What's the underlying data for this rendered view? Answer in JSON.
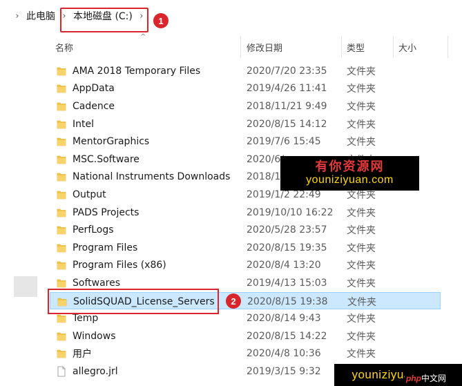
{
  "breadcrumb": {
    "items": [
      "此电脑",
      "本地磁盘 (C:)"
    ],
    "badge1": "1"
  },
  "columns": {
    "name": "名称",
    "modified": "修改日期",
    "type": "类型",
    "size": "大小"
  },
  "files": [
    {
      "name": "AMA 2018 Temporary Files",
      "date": "2020/7/20 23:35",
      "type": "文件夹",
      "icon": "folder-icon"
    },
    {
      "name": "AppData",
      "date": "2019/4/26 11:41",
      "type": "文件夹",
      "icon": "folder-icon"
    },
    {
      "name": "Cadence",
      "date": "2018/11/21 9:49",
      "type": "文件夹",
      "icon": "folder-icon"
    },
    {
      "name": "Intel",
      "date": "2020/8/15 14:12",
      "type": "文件夹",
      "icon": "folder-icon"
    },
    {
      "name": "MentorGraphics",
      "date": "2019/7/6 15:45",
      "type": "文件夹",
      "icon": "folder-icon"
    },
    {
      "name": "MSC.Software",
      "date": "2020/6/",
      "type": "文件夹",
      "icon": "folder-icon"
    },
    {
      "name": "National Instruments Downloads",
      "date": "2018/1",
      "type": "文件夹",
      "icon": "folder-icon"
    },
    {
      "name": "Output",
      "date": "2019/1/2 22:49",
      "type": "文件夹",
      "icon": "folder-icon"
    },
    {
      "name": "PADS Projects",
      "date": "2019/10/10 16:22",
      "type": "文件夹",
      "icon": "folder-icon"
    },
    {
      "name": "PerfLogs",
      "date": "2020/5/28 23:57",
      "type": "文件夹",
      "icon": "folder-icon"
    },
    {
      "name": "Program Files",
      "date": "2020/8/15 19:35",
      "type": "文件夹",
      "icon": "folder-icon"
    },
    {
      "name": "Program Files (x86)",
      "date": "2020/8/4 13:20",
      "type": "文件夹",
      "icon": "folder-icon"
    },
    {
      "name": "Softwares",
      "date": "2019/4/13 15:03",
      "type": "文件夹",
      "icon": "folder-icon"
    },
    {
      "name": "SolidSQUAD_License_Servers",
      "date": "2020/8/15 19:38",
      "type": "文件夹",
      "icon": "folder-icon",
      "selected": true
    },
    {
      "name": "Temp",
      "date": "2020/8/14 9:43",
      "type": "文件夹",
      "icon": "folder-icon"
    },
    {
      "name": "Windows",
      "date": "2020/8/15 14:22",
      "type": "文件夹",
      "icon": "folder-icon"
    },
    {
      "name": "用户",
      "date": "2020/4/8 10:36",
      "type": "文件夹",
      "icon": "folder-icon"
    },
    {
      "name": "allegro.jrl",
      "date": "2019/3/15 9:32",
      "type": "",
      "icon": "file-icon"
    }
  ],
  "badge2": "2",
  "watermark": {
    "cn": "有你资源网",
    "en": "youniziyuan.com",
    "en2": "youniziyuan.com",
    "php": "php",
    "php_suffix": "中文网"
  },
  "colors": {
    "folder": "#f4c542",
    "selection": "#cce8ff",
    "annotation": "#d9262c"
  }
}
